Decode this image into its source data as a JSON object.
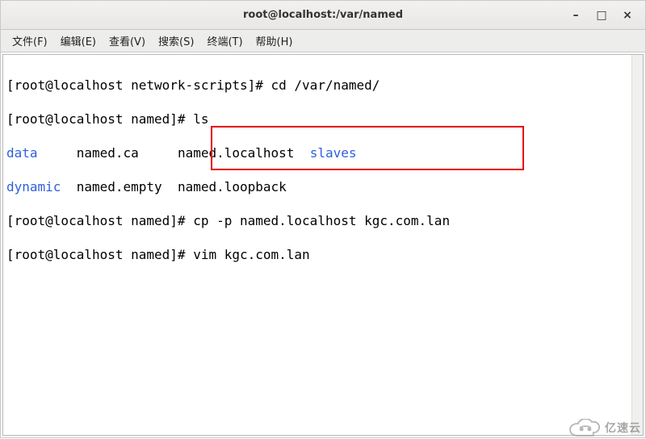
{
  "window": {
    "title": "root@localhost:/var/named"
  },
  "minimize_label": "–",
  "maximize_label": "□",
  "close_label": "×",
  "menubar": {
    "items": [
      {
        "label": "文件(F)"
      },
      {
        "label": "编辑(E)"
      },
      {
        "label": "查看(V)"
      },
      {
        "label": "搜索(S)"
      },
      {
        "label": "终端(T)"
      },
      {
        "label": "帮助(H)"
      }
    ]
  },
  "terminal": {
    "line1_prompt": "[root@localhost network-scripts]# ",
    "line1_cmd": "cd /var/named/",
    "line2_prompt": "[root@localhost named]# ",
    "line2_cmd": "ls",
    "ls_row1_col1": "data",
    "ls_row1_col2": "named.ca",
    "ls_row1_col3": "named.localhost",
    "ls_row1_col4": "slaves",
    "ls_row2_col1": "dynamic",
    "ls_row2_col2": "named.empty",
    "ls_row2_col3": "named.loopback",
    "line5_prompt": "[root@localhost named]# ",
    "line5_cmd": "cp -p named.localhost kgc.com.lan",
    "line6_prompt": "[root@localhost named]# ",
    "line6_cmd": "vim kgc.com.lan"
  },
  "watermark": {
    "text": "亿速云"
  }
}
